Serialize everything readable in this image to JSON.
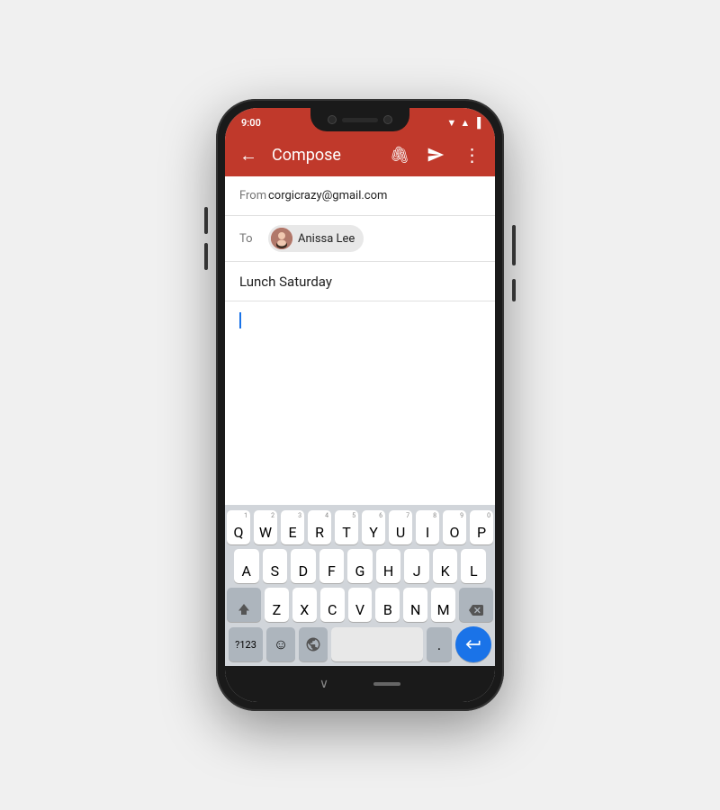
{
  "status_bar": {
    "time": "9:00"
  },
  "app_bar": {
    "title": "Compose",
    "back_label": "←",
    "attach_label": "📎",
    "send_label": "▶",
    "more_label": "⋮"
  },
  "compose": {
    "from_label": "From",
    "from_value": "corgicrazy@gmail.com",
    "to_label": "To",
    "recipient_name": "Anissa Lee",
    "subject": "Lunch Saturday",
    "body": ""
  },
  "keyboard": {
    "row1": [
      "Q",
      "W",
      "E",
      "R",
      "T",
      "Y",
      "U",
      "I",
      "O",
      "P"
    ],
    "row1_nums": [
      "1",
      "2",
      "3",
      "4",
      "5",
      "6",
      "7",
      "8",
      "9",
      "0"
    ],
    "row2": [
      "A",
      "S",
      "D",
      "F",
      "G",
      "H",
      "J",
      "K",
      "L"
    ],
    "row3": [
      "Z",
      "X",
      "C",
      "V",
      "B",
      "N",
      "M"
    ],
    "special_123": "?123",
    "period": ".",
    "bottom_labels": {
      "numbers": "?123",
      "emoji": "☺",
      "globe": "🌐"
    }
  }
}
